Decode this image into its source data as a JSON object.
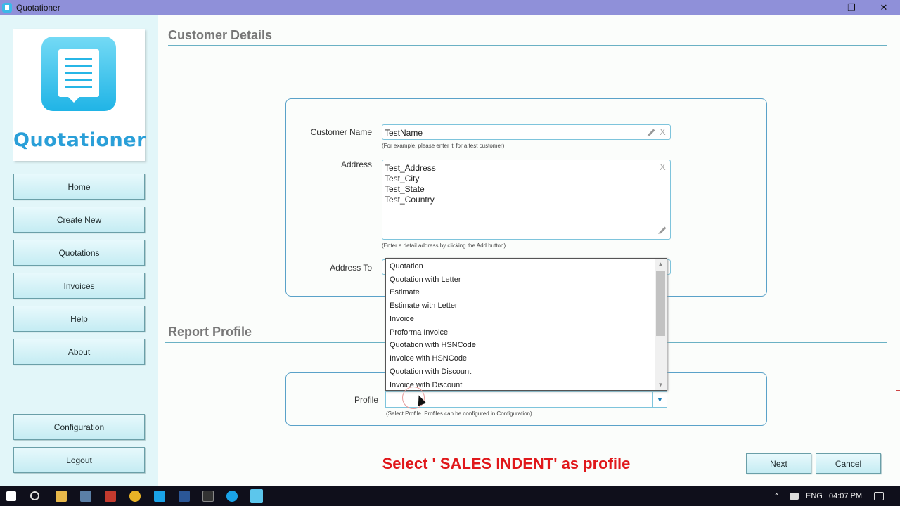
{
  "window": {
    "title": "Quotationer",
    "minimize": "—",
    "restore": "❐",
    "close": "✕"
  },
  "sidebar": {
    "logo_text": "Quotationer",
    "items": [
      {
        "label": "Home"
      },
      {
        "label": "Create New"
      },
      {
        "label": "Quotations"
      },
      {
        "label": "Invoices"
      },
      {
        "label": "Help"
      },
      {
        "label": "About"
      }
    ],
    "bottom_items": [
      {
        "label": "Configuration"
      },
      {
        "label": "Logout"
      }
    ]
  },
  "customer": {
    "section_title": "Customer Details",
    "name_label": "Customer Name",
    "name_value": "TestName",
    "name_hint": "(For example, please enter 't' for a test customer)",
    "address_label": "Address",
    "address_value": "Test_Address\nTest_City\nTest_State\nTest_Country",
    "address_hint": "(Enter a detail address by clicking the Add button)",
    "address_to_label": "Address To",
    "clear_glyph": "X"
  },
  "profile": {
    "section_title": "Report Profile",
    "label": "Profile",
    "selected": "",
    "hint": "(Select Profile. Profiles can be configured in Configuration)",
    "options": [
      "Quotation",
      "Quotation with Letter",
      "Estimate",
      "Estimate with Letter",
      "Invoice",
      "Proforma Invoice",
      "Quotation with HSNCode",
      "Invoice with HSNCode",
      "Quotation with Discount",
      "Invoice with Discount"
    ]
  },
  "instruction": "Select ' SALES INDENT' as profile",
  "actions": {
    "next": "Next",
    "cancel": "Cancel"
  },
  "taskbar": {
    "language": "ENG",
    "time": "04:07 PM"
  },
  "colors": {
    "titlebar": "#8f90d9",
    "sidebar_bg": "#e2f6f9",
    "accent": "#2a9fd8",
    "instruction": "#e0181b"
  }
}
